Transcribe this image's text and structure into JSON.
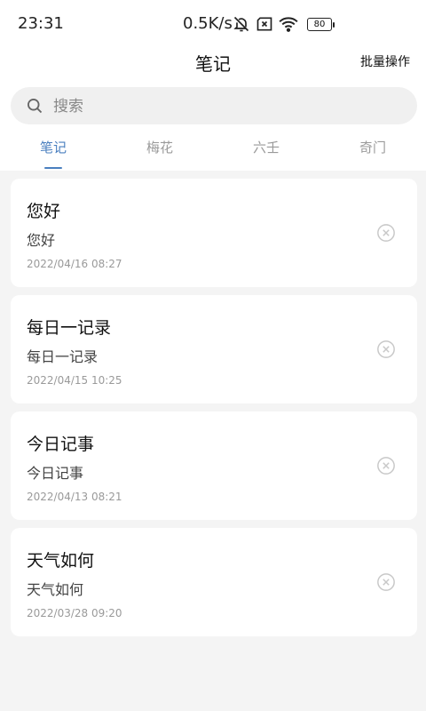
{
  "status_bar": {
    "time": "23:31",
    "net_speed": "0.5K/s",
    "battery": "80"
  },
  "header": {
    "title": "笔记",
    "batch_label": "批量操作"
  },
  "search": {
    "placeholder": "搜索"
  },
  "tabs": [
    {
      "label": "笔记",
      "active": true
    },
    {
      "label": "梅花",
      "active": false
    },
    {
      "label": "六壬",
      "active": false
    },
    {
      "label": "奇门",
      "active": false
    }
  ],
  "notes": [
    {
      "title": "您好",
      "content": "您好",
      "date": "2022/04/16 08:27"
    },
    {
      "title": "每日一记录",
      "content": "每日一记录",
      "date": "2022/04/15 10:25"
    },
    {
      "title": "今日记事",
      "content": "今日记事",
      "date": "2022/04/13 08:21"
    },
    {
      "title": "天气如何",
      "content": "天气如何",
      "date": "2022/03/28 09:20"
    }
  ],
  "icons": {
    "search": "search-icon",
    "delete": "close-circle-icon",
    "mute": "bell-off-icon",
    "sim": "no-sim-icon",
    "wifi": "wifi-icon"
  },
  "colors": {
    "accent": "#4a7fbf",
    "background": "#f4f4f4",
    "card": "#ffffff"
  }
}
